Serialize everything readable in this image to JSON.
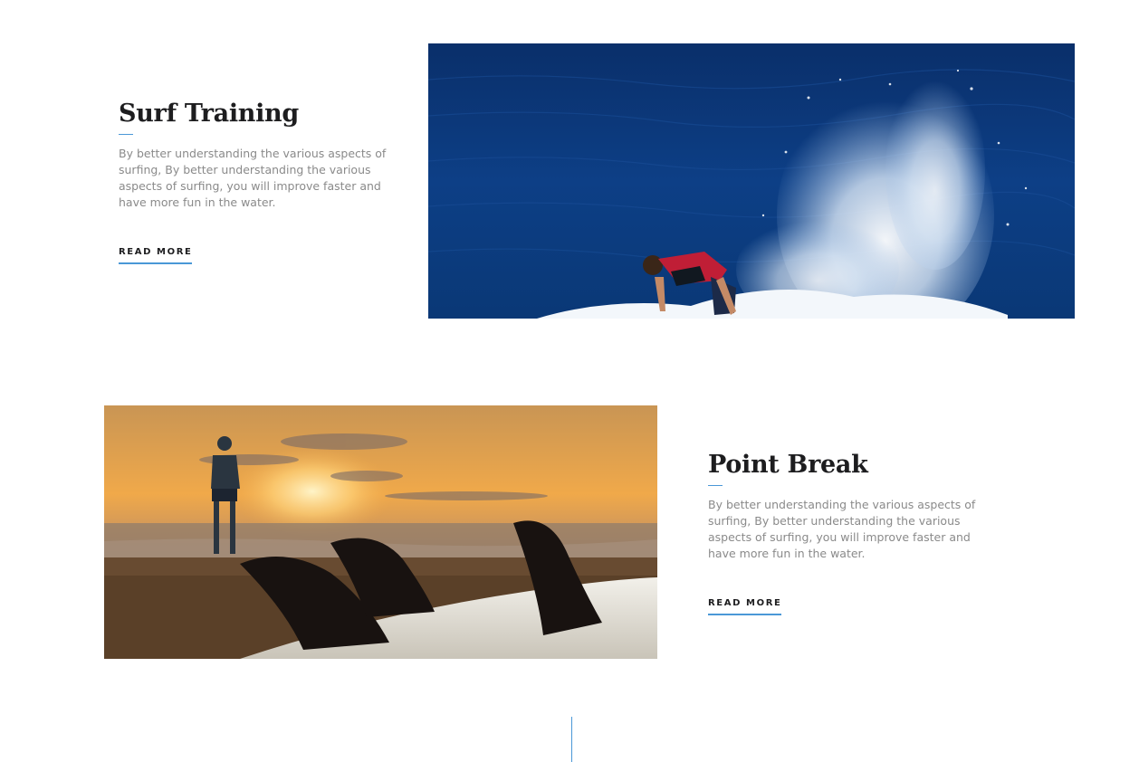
{
  "features": [
    {
      "title": "Surf Training",
      "description": "By better understanding the various aspects of surfing, By better understanding the various aspects of surfing, you will improve faster and have more fun in the water.",
      "cta": "READ MORE",
      "image_icon": "surfer-wave-photo"
    },
    {
      "title": "Point Break",
      "description": "By better understanding the various aspects of surfing, By better understanding the various aspects of surfing, you will improve faster and have more fun in the water.",
      "cta": "READ MORE",
      "image_icon": "surfboard-fins-sunset-photo"
    }
  ],
  "colors": {
    "accent": "#4a98d7",
    "heading": "#1d1d1f",
    "body_text": "#8a8a8a",
    "ocean": "#0b3a78",
    "sunset": "#f0a94a"
  }
}
